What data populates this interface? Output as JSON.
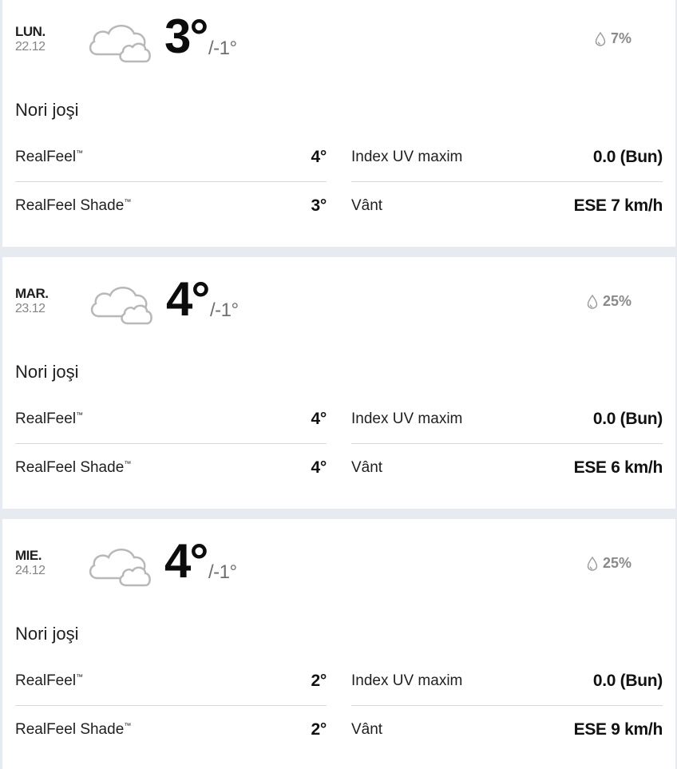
{
  "days": [
    {
      "day": "LUN.",
      "date": "22.12",
      "icon": "cloudy-icon",
      "temp_high": "3°",
      "temp_low": "/-1°",
      "precip": "7%",
      "phrase": "Nori joşi",
      "realfeel_label": "RealFeel",
      "realfeel_value": "4°",
      "realfeel_shade_label": "RealFeel Shade",
      "realfeel_shade_value": "3°",
      "uv_label": "Index UV maxim",
      "uv_value": "0.0 (Bun)",
      "wind_label": "Vânt",
      "wind_value": "ESE 7 km/h"
    },
    {
      "day": "MAR.",
      "date": "23.12",
      "icon": "cloudy-icon",
      "temp_high": "4°",
      "temp_low": "/-1°",
      "precip": "25%",
      "phrase": "Nori joşi",
      "realfeel_label": "RealFeel",
      "realfeel_value": "4°",
      "realfeel_shade_label": "RealFeel Shade",
      "realfeel_shade_value": "4°",
      "uv_label": "Index UV maxim",
      "uv_value": "0.0 (Bun)",
      "wind_label": "Vânt",
      "wind_value": "ESE 6 km/h"
    },
    {
      "day": "MIE.",
      "date": "24.12",
      "icon": "cloudy-icon",
      "temp_high": "4°",
      "temp_low": "/-1°",
      "precip": "25%",
      "phrase": "Nori joşi",
      "realfeel_label": "RealFeel",
      "realfeel_value": "2°",
      "realfeel_shade_label": "RealFeel Shade",
      "realfeel_shade_value": "2°",
      "uv_label": "Index UV maxim",
      "uv_value": "0.0 (Bun)",
      "wind_label": "Vânt",
      "wind_value": "ESE 9 km/h"
    }
  ],
  "trademark": "™",
  "colors": {
    "background": "#e6ebf2",
    "card": "#ffffff",
    "muted_text": "#858585",
    "icon_stroke": "#b8b8b8"
  }
}
